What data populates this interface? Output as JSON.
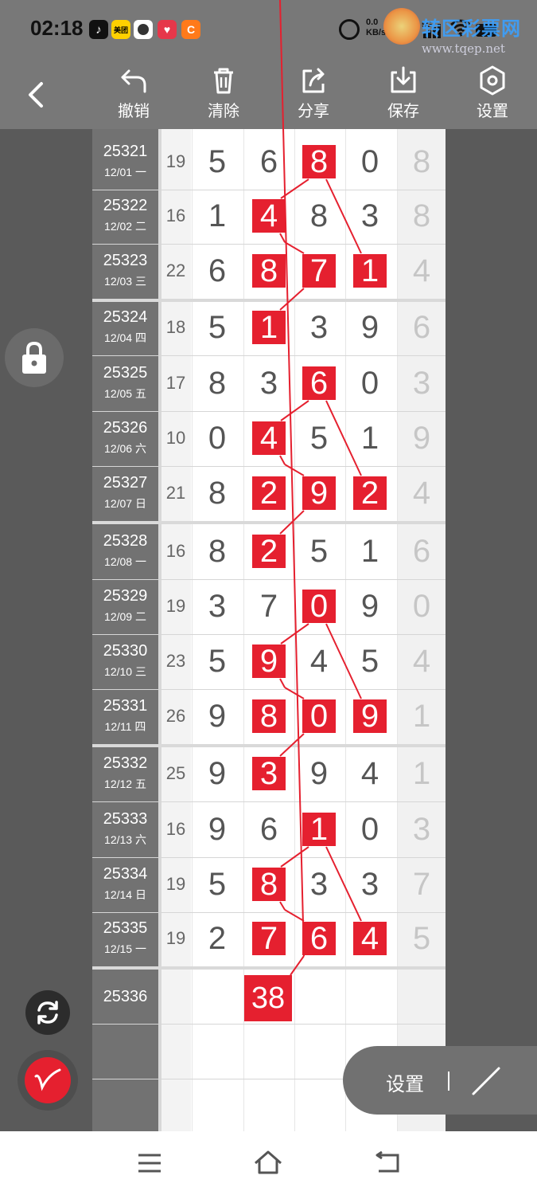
{
  "status_bar": {
    "time": "02:18",
    "apps": [
      "tiktok-icon",
      "meituan-icon",
      "avatar-icon",
      "heart-app-icon",
      "orange-app-icon"
    ],
    "network_speed": "0.0",
    "network_speed_unit": "KB/s",
    "signal_label": "5G",
    "watermark": {
      "title": "转区彩票网",
      "url": "www.tqep.net"
    }
  },
  "toolbar": {
    "back_label": "back",
    "undo_label": "撤销",
    "clear_label": "清除",
    "share_label": "分享",
    "save_label": "保存",
    "settings_label": "设置"
  },
  "table": {
    "rows": [
      {
        "issue": "25321",
        "date": "12/01 一",
        "sum": "19",
        "digits": [
          "5",
          "6",
          "8",
          "0"
        ],
        "tail": "8",
        "hl": [
          2
        ]
      },
      {
        "issue": "25322",
        "date": "12/02 二",
        "sum": "16",
        "digits": [
          "1",
          "4",
          "8",
          "3"
        ],
        "tail": "8",
        "hl": [
          1
        ]
      },
      {
        "issue": "25323",
        "date": "12/03 三",
        "sum": "22",
        "digits": [
          "6",
          "8",
          "7",
          "1"
        ],
        "tail": "4",
        "hl": [
          1,
          2,
          3
        ]
      },
      {
        "issue": "25324",
        "date": "12/04 四",
        "sum": "18",
        "digits": [
          "5",
          "1",
          "3",
          "9"
        ],
        "tail": "6",
        "hl": [
          1
        ]
      },
      {
        "issue": "25325",
        "date": "12/05 五",
        "sum": "17",
        "digits": [
          "8",
          "3",
          "6",
          "0"
        ],
        "tail": "3",
        "hl": [
          2
        ]
      },
      {
        "issue": "25326",
        "date": "12/06 六",
        "sum": "10",
        "digits": [
          "0",
          "4",
          "5",
          "1"
        ],
        "tail": "9",
        "hl": [
          1
        ]
      },
      {
        "issue": "25327",
        "date": "12/07 日",
        "sum": "21",
        "digits": [
          "8",
          "2",
          "9",
          "2"
        ],
        "tail": "4",
        "hl": [
          1,
          2,
          3
        ]
      },
      {
        "issue": "25328",
        "date": "12/08 一",
        "sum": "16",
        "digits": [
          "8",
          "2",
          "5",
          "1"
        ],
        "tail": "6",
        "hl": [
          1
        ]
      },
      {
        "issue": "25329",
        "date": "12/09 二",
        "sum": "19",
        "digits": [
          "3",
          "7",
          "0",
          "9"
        ],
        "tail": "0",
        "hl": [
          2
        ]
      },
      {
        "issue": "25330",
        "date": "12/10 三",
        "sum": "23",
        "digits": [
          "5",
          "9",
          "4",
          "5"
        ],
        "tail": "4",
        "hl": [
          1
        ]
      },
      {
        "issue": "25331",
        "date": "12/11 四",
        "sum": "26",
        "digits": [
          "9",
          "8",
          "0",
          "9"
        ],
        "tail": "1",
        "hl": [
          1,
          2,
          3
        ]
      },
      {
        "issue": "25332",
        "date": "12/12 五",
        "sum": "25",
        "digits": [
          "9",
          "3",
          "9",
          "4"
        ],
        "tail": "1",
        "hl": [
          1
        ]
      },
      {
        "issue": "25333",
        "date": "12/13 六",
        "sum": "16",
        "digits": [
          "9",
          "6",
          "1",
          "0"
        ],
        "tail": "3",
        "hl": [
          2
        ]
      },
      {
        "issue": "25334",
        "date": "12/14 日",
        "sum": "19",
        "digits": [
          "5",
          "8",
          "3",
          "3"
        ],
        "tail": "7",
        "hl": [
          1
        ]
      },
      {
        "issue": "25335",
        "date": "12/15 一",
        "sum": "19",
        "digits": [
          "2",
          "7",
          "6",
          "4"
        ],
        "tail": "5",
        "hl": [
          1,
          2,
          3
        ]
      }
    ],
    "next_issue": "25336",
    "prediction": "38"
  },
  "floating": {
    "settings_label": "设置"
  },
  "colors": {
    "highlight_red": "#e5202f",
    "bar_gray": "#787878",
    "issue_col_gray": "#727272"
  }
}
